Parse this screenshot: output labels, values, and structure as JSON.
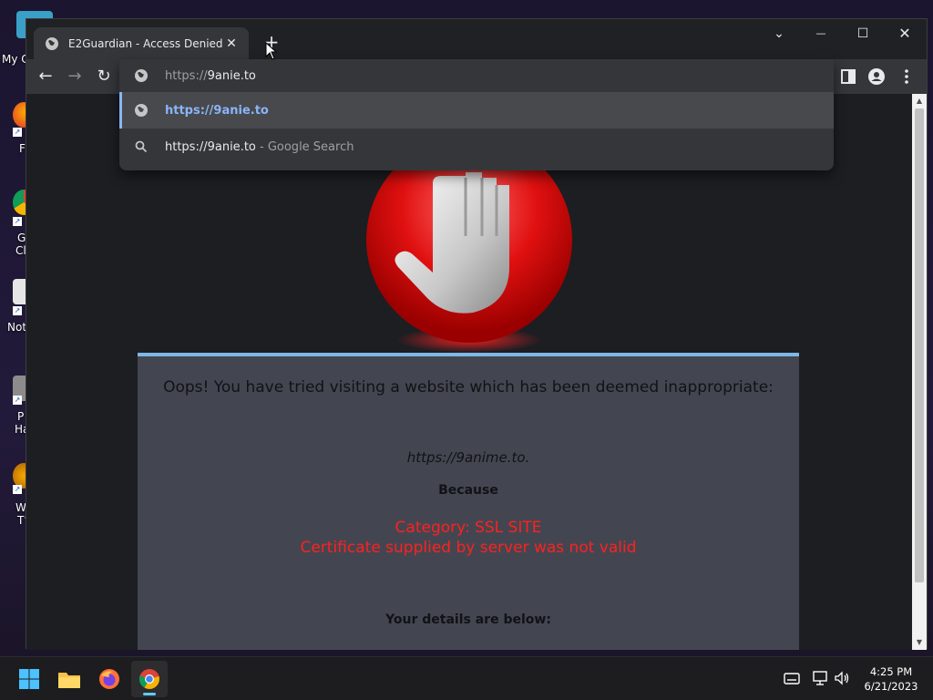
{
  "desktop": {
    "icons": [
      {
        "label": "My C",
        "icon": "computer-icon"
      },
      {
        "label": "F",
        "icon": "firefox-shortcut-icon"
      },
      {
        "label": "G",
        "label2": "Cl",
        "icon": "chrome-shortcut-icon"
      },
      {
        "label": "Not",
        "icon": "notepad-shortcut-icon"
      },
      {
        "label": "P",
        "label2": "Ha",
        "icon": "app-shortcut-icon"
      },
      {
        "label": "W",
        "label2": "T’",
        "icon": "app-shortcut-icon"
      }
    ]
  },
  "browser": {
    "tab": {
      "title": "E2Guardian - Access Denied",
      "close": "✕"
    },
    "new_tab": "+",
    "window_controls": {
      "dropdown": "⌄",
      "minimize": "—",
      "maximize": "☐",
      "close": "✕"
    },
    "nav": {
      "back": "←",
      "forward": "→",
      "reload": "↻"
    },
    "omnibox": {
      "typed_prefix": "https://",
      "typed_value": "9anie.to",
      "suggestions": [
        {
          "text": "https://9anie.to",
          "suffix": "",
          "icon": "globe-icon",
          "selected": true
        },
        {
          "text": "https://9anie.to",
          "suffix": " - Google Search",
          "icon": "search-icon",
          "selected": false
        }
      ]
    }
  },
  "page": {
    "headline": "Oops! You have tried visiting a website which has been deemed inappropriate:",
    "blocked_url": "https://9anime.to.",
    "because": "Because",
    "category_line1": "Category: SSL SITE",
    "category_line2": "Certificate supplied by server was not valid",
    "details": "Your details are below:"
  },
  "taskbar": {
    "apps": [
      "windows-start-icon",
      "file-explorer-icon",
      "firefox-icon",
      "chrome-icon"
    ],
    "clock": {
      "time": "4:25 PM",
      "date": "6/21/2023"
    }
  },
  "colors": {
    "accent_blue": "#8ab4f8",
    "panel_border": "#7fb7e6",
    "error_red": "#ff2020",
    "panel_bg": "#434650"
  }
}
